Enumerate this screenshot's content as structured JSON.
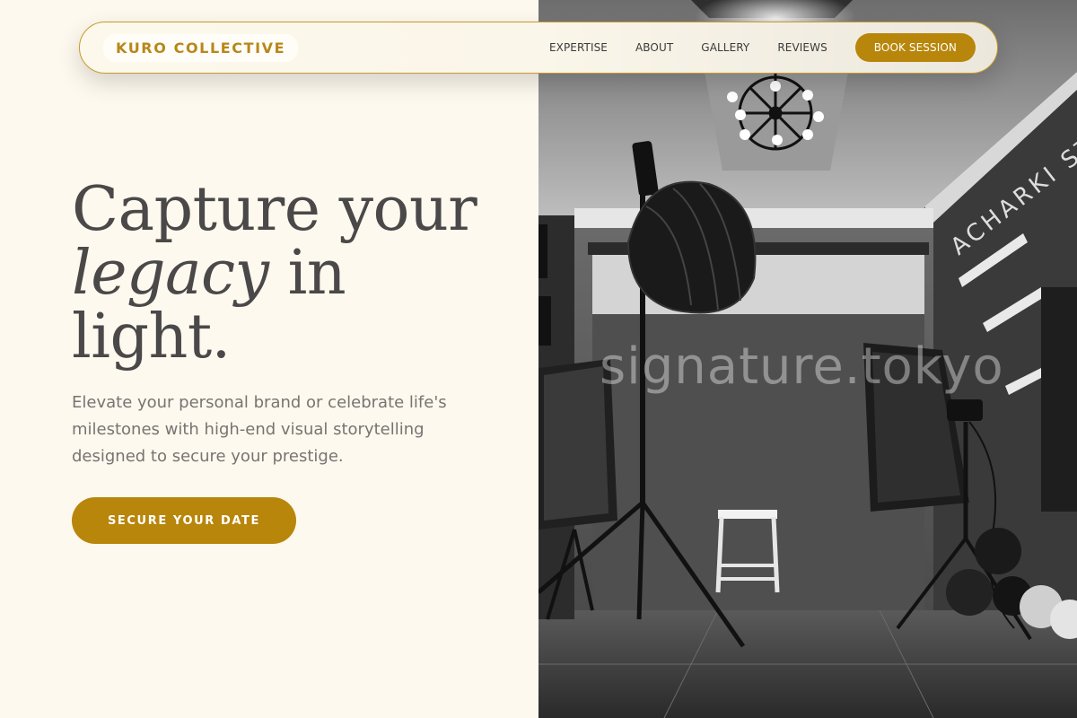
{
  "brand": {
    "logo_text": "KURO COLLECTIVE",
    "accent_color": "#b8860b",
    "background_color": "#fdf9ee"
  },
  "nav": {
    "links": [
      "EXPERTISE",
      "ABOUT",
      "GALLERY",
      "REVIEWS"
    ],
    "book_label": "BOOK SESSION"
  },
  "hero": {
    "title_line1": "Capture your",
    "title_italic": "legacy",
    "title_after_italic": " in",
    "title_line3": "light.",
    "subtitle": "Elevate your personal brand or celebrate life's milestones with high-end visual storytelling designed to secure your prestige.",
    "cta_label": "SECURE YOUR DATE"
  },
  "photo": {
    "watermark": "signature.tokyo",
    "wall_sign": "ACHARKI ST",
    "icon": "photo-studio-image"
  }
}
